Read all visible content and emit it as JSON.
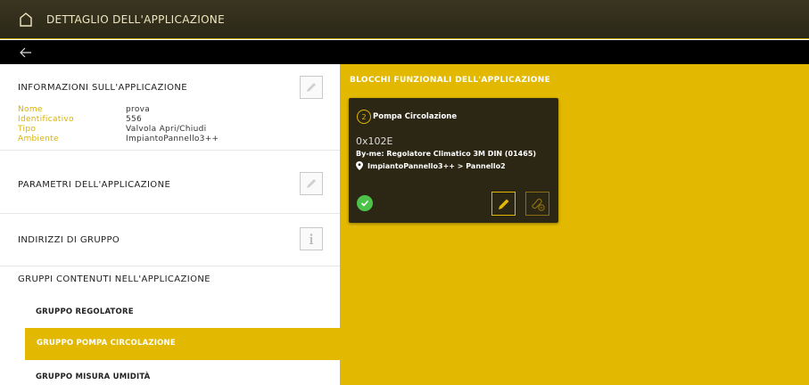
{
  "header": {
    "title": "DETTAGLIO DELL'APPLICAZIONE",
    "home_icon": "home-icon"
  },
  "nav": {
    "back_icon": "arrow-left-icon"
  },
  "left": {
    "info_section": {
      "title": "INFORMAZIONI SULL'APPLICAZIONE",
      "rows": [
        {
          "key": "Nome",
          "value": "prova"
        },
        {
          "key": "Identificativo",
          "value": "556"
        },
        {
          "key": "Tipo",
          "value": "Valvola Apri/Chiudi"
        },
        {
          "key": "Ambiente",
          "value": "ImpiantoPannello3++"
        }
      ]
    },
    "params_section": {
      "title": "PARAMETRI DELL'APPLICAZIONE"
    },
    "group_addr_section": {
      "title": "INDIRIZZI DI GRUPPO"
    },
    "groups_section": {
      "title": "GRUPPI CONTENUTI NELL'APPLICAZIONE",
      "items": [
        "GRUPPO REGOLATORE",
        "GRUPPO POMPA CIRCOLAZIONE",
        "GRUPPO MISURA UMIDITÀ"
      ],
      "active_index": 1
    }
  },
  "right": {
    "title": "BLOCCHI FUNZIONALI DELL'APPLICAZIONE",
    "card": {
      "number": "2",
      "name": "Pompa Circolazione",
      "address": "0x102E",
      "byme": "By-me: Regolatore Climatico 3M DIN (01465)",
      "location": "ImpiantoPannello3++ > Pannello2",
      "status": "ok"
    }
  },
  "colors": {
    "accent": "#e2b900",
    "card_bg": "#2c2614",
    "ok": "#4cc24a"
  }
}
